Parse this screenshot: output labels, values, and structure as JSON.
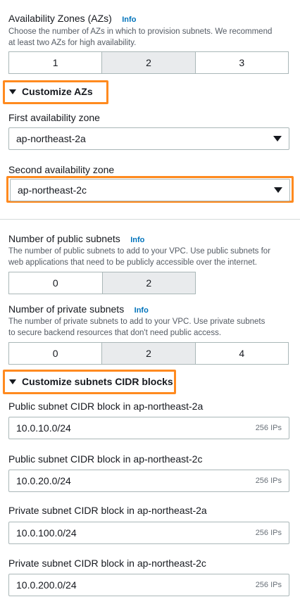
{
  "az": {
    "title": "Availability Zones (AZs)",
    "info": "Info",
    "desc1": "Choose the number of AZs in which to provision subnets. We recommend",
    "desc2": "at least two AZs for high availability.",
    "options": [
      "1",
      "2",
      "3"
    ],
    "selected": "2"
  },
  "customize_azs": {
    "label": "Customize AZs",
    "first_label": "First availability zone",
    "first_value": "ap-northeast-2a",
    "second_label": "Second availability zone",
    "second_value": "ap-northeast-2c"
  },
  "public_subnets": {
    "title": "Number of public subnets",
    "info": "Info",
    "desc1": "The number of public subnets to add to your VPC. Use public subnets for",
    "desc2": "web applications that need to be publicly accessible over the internet.",
    "options": [
      "0",
      "2"
    ],
    "selected": "2"
  },
  "private_subnets": {
    "title": "Number of private subnets",
    "info": "Info",
    "desc1": "The number of private subnets to add to your VPC. Use private subnets",
    "desc2": "to secure backend resources that don't need public access.",
    "options": [
      "0",
      "2",
      "4"
    ],
    "selected": "2"
  },
  "cidr": {
    "label": "Customize subnets CIDR blocks",
    "blocks": [
      {
        "label": "Public subnet CIDR block in ap-northeast-2a",
        "value": "10.0.10.0/24",
        "ips": "256 IPs"
      },
      {
        "label": "Public subnet CIDR block in ap-northeast-2c",
        "value": "10.0.20.0/24",
        "ips": "256 IPs"
      },
      {
        "label": "Private subnet CIDR block in ap-northeast-2a",
        "value": "10.0.100.0/24",
        "ips": "256 IPs"
      },
      {
        "label": "Private subnet CIDR block in ap-northeast-2c",
        "value": "10.0.200.0/24",
        "ips": "256 IPs"
      }
    ]
  },
  "colors": {
    "highlight": "#ff8a1f",
    "link": "#0073bb",
    "selected_bg": "#e9ebed",
    "border": "#aab7b8"
  }
}
